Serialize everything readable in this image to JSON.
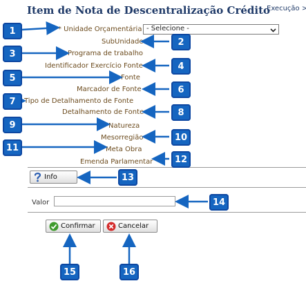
{
  "header": {
    "title": "Item de Nota de Descentralização Crédito",
    "breadcrumb": "Execução >"
  },
  "form": {
    "unidade_orcamentaria_label": "* Unidade Orçamentária",
    "unidade_orcamentaria_selected": "- Selecione -",
    "subunidade_label": "SubUnidade",
    "programa_label": "Programa de trabalho",
    "identificador_label": "Identificador Exercício Fonte",
    "fonte_label": "Fonte",
    "marcador_label": "Marcador de Fonte",
    "tipo_detalhamento_label": "Tipo de Detalhamento de Fonte",
    "detalhamento_label": "Detalhamento de Fonte",
    "natureza_label": "Natureza",
    "mesorregiao_label": "Mesorregião",
    "meta_obra_label": "Meta Obra",
    "emenda_label": "Emenda Parlamentar",
    "valor_label": "Valor",
    "valor_value": ""
  },
  "buttons": {
    "info": "Info",
    "confirmar": "Confirmar",
    "cancelar": "Cancelar"
  },
  "badges": [
    "1",
    "2",
    "3",
    "4",
    "5",
    "6",
    "7",
    "8",
    "9",
    "10",
    "11",
    "12",
    "13",
    "14",
    "15",
    "16"
  ],
  "colors": {
    "badge": "#1565c0",
    "title": "#1f3a68",
    "field_label": "#6b4a1c"
  }
}
